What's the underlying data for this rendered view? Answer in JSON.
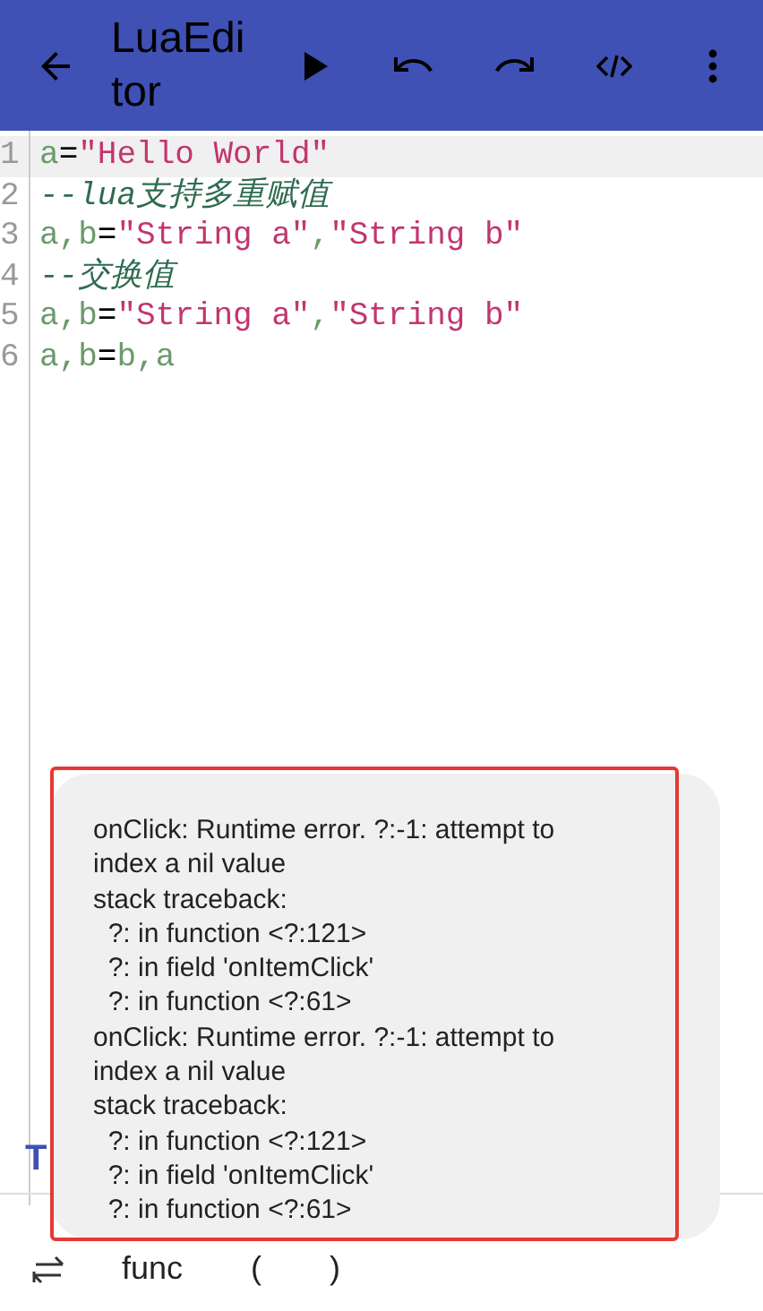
{
  "app_bar": {
    "title": "LuaEditor"
  },
  "editor": {
    "lines": [
      {
        "number": "1",
        "current": true,
        "tokens": [
          {
            "kind": "ident",
            "text": "a"
          },
          {
            "kind": "op",
            "text": "="
          },
          {
            "kind": "string",
            "text": "\"Hello World\""
          }
        ]
      },
      {
        "number": "2",
        "current": false,
        "tokens": [
          {
            "kind": "comment",
            "text": "--lua支持多重赋值"
          }
        ]
      },
      {
        "number": "3",
        "current": false,
        "tokens": [
          {
            "kind": "ident",
            "text": "a,b"
          },
          {
            "kind": "op",
            "text": "="
          },
          {
            "kind": "string",
            "text": "\"String a\""
          },
          {
            "kind": "ident",
            "text": ","
          },
          {
            "kind": "string",
            "text": "\"String b\""
          }
        ]
      },
      {
        "number": "4",
        "current": false,
        "tokens": [
          {
            "kind": "comment",
            "text": "--交换值"
          }
        ]
      },
      {
        "number": "5",
        "current": false,
        "tokens": [
          {
            "kind": "ident",
            "text": "a,b"
          },
          {
            "kind": "op",
            "text": "="
          },
          {
            "kind": "string",
            "text": "\"String a\""
          },
          {
            "kind": "ident",
            "text": ","
          },
          {
            "kind": "string",
            "text": "\"String b\""
          }
        ]
      },
      {
        "number": "6",
        "current": false,
        "tokens": [
          {
            "kind": "ident",
            "text": "a,b"
          },
          {
            "kind": "op",
            "text": "="
          },
          {
            "kind": "ident",
            "text": "b,a"
          }
        ]
      }
    ]
  },
  "partial_tab": "T",
  "symbol_bar": {
    "keys": [
      "func",
      "(",
      ")"
    ]
  },
  "toast": {
    "highlighted": true,
    "lines": [
      "onClick: Runtime error. ?:-1: attempt to index a nil value",
      "stack traceback:",
      "  ?: in function <?:121>",
      "  ?: in field 'onItemClick'",
      "  ?: in function <?:61>",
      "onClick: Runtime error. ?:-1: attempt to index a nil value",
      "stack traceback:",
      "  ?: in function <?:121>",
      "  ?: in field 'onItemClick'",
      "  ?: in function <?:61>"
    ]
  }
}
